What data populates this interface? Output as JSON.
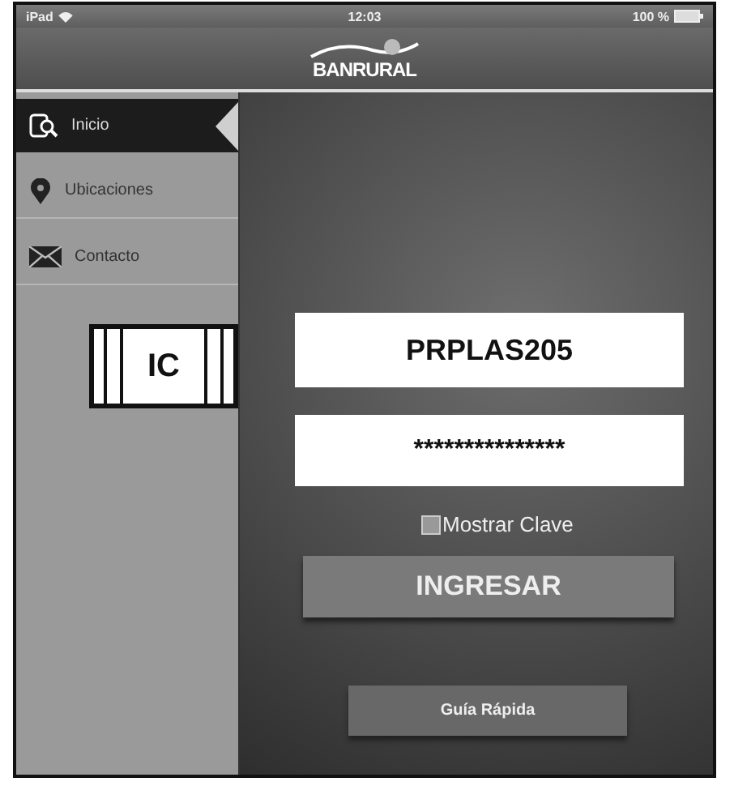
{
  "status_bar": {
    "device": "iPad",
    "time": "12:03",
    "battery": "100 %"
  },
  "header": {
    "logo": "BANRURAL"
  },
  "sidebar": {
    "items": [
      {
        "label": "Inicio",
        "kind": "search",
        "selected": true
      },
      {
        "label": "Ubicaciones",
        "kind": "pin",
        "selected": false
      },
      {
        "label": "Contacto",
        "kind": "mail",
        "selected": false
      }
    ]
  },
  "ic_label": "IC",
  "login": {
    "username": "PRPLAS205",
    "password": "***************",
    "show_password": {
      "label": "Mostrar Clave",
      "checked": false
    },
    "submit": "INGRESAR",
    "guide": "Guía Rápida"
  }
}
